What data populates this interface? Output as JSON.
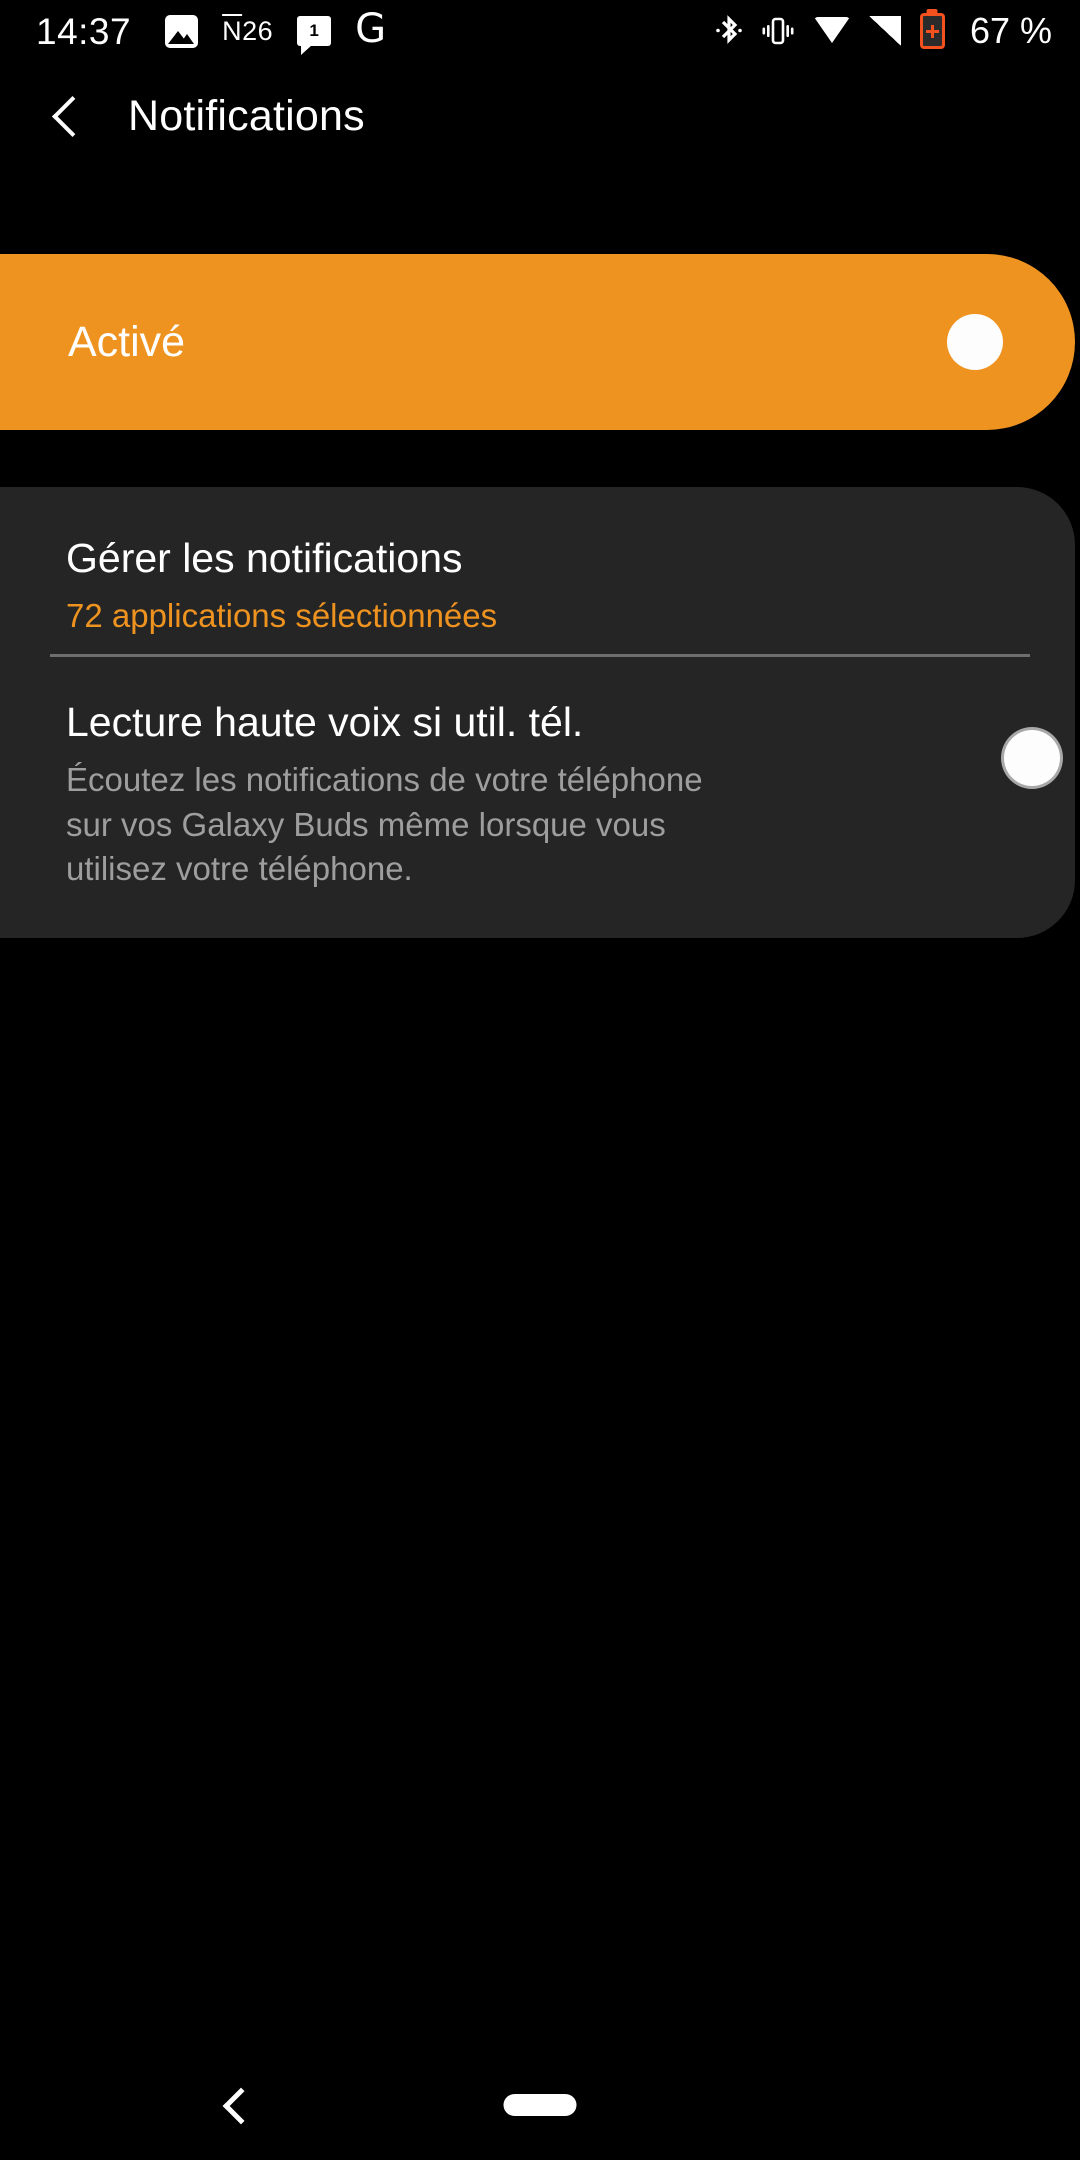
{
  "status_bar": {
    "time": "14:37",
    "left_icons": [
      {
        "name": "gallery-icon",
        "label": ""
      },
      {
        "name": "n26-icon",
        "label": "N26"
      },
      {
        "name": "message-icon",
        "label": "1"
      },
      {
        "name": "google-icon",
        "label": "G"
      }
    ],
    "right_icons": [
      {
        "name": "bluetooth-icon"
      },
      {
        "name": "vibrate-icon"
      },
      {
        "name": "wifi-icon"
      },
      {
        "name": "cellular-signal-icon"
      },
      {
        "name": "battery-icon"
      }
    ],
    "battery_percent": "67 %",
    "battery_color": "#f4511e"
  },
  "app_bar": {
    "title": "Notifications",
    "back_label": "back"
  },
  "enable_card": {
    "label": "Activé",
    "toggle_state": "on",
    "background_color": "#ef9320"
  },
  "settings_card": {
    "background_color": "#252525",
    "manage": {
      "title": "Gérer les notifications",
      "subtitle": "72 applications sélectionnées",
      "subtitle_color": "#ef9320"
    },
    "read_aloud": {
      "title": "Lecture haute voix si util. tél.",
      "description": "Écoutez les notifications de votre téléphone sur vos Galaxy Buds même lorsque vous utilisez votre téléphone.",
      "toggle_state": "off"
    }
  },
  "nav_bar": {
    "back_icon": "nav-back-icon",
    "home_icon": "nav-home-indicator"
  }
}
